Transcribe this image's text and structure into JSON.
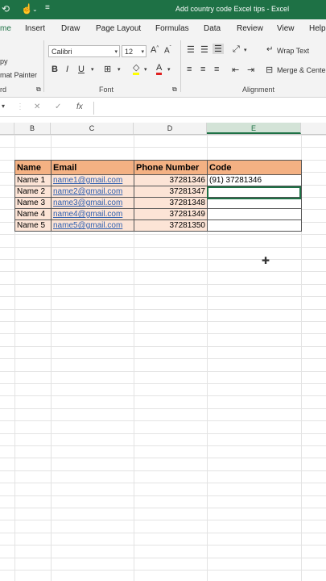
{
  "window": {
    "title": "Add country code Excel tips  -  Excel"
  },
  "tabs": [
    "me",
    "Insert",
    "Draw",
    "Page Layout",
    "Formulas",
    "Data",
    "Review",
    "View",
    "Help"
  ],
  "ribbon": {
    "clipboard": {
      "copy": "py",
      "format_painter": "mat Painter",
      "group": "rd"
    },
    "font": {
      "name": "Calibri",
      "size": "12",
      "group": "Font"
    },
    "alignment": {
      "wrap_text": "Wrap Text",
      "merge_center": "Merge & Cente",
      "group": "Alignment"
    }
  },
  "formula_bar": {
    "fx": "fx",
    "value": ""
  },
  "columns": [
    "B",
    "C",
    "D",
    "E"
  ],
  "table": {
    "headers": [
      "Name",
      "Email",
      "Phone Number",
      "Code"
    ],
    "rows": [
      {
        "name": "Name 1",
        "email": "name1@gmail.com",
        "phone": "37281346",
        "code": "(91) 37281346"
      },
      {
        "name": "Name 2",
        "email": "name2@gmail.com",
        "phone": "37281347",
        "code": ""
      },
      {
        "name": "Name 3",
        "email": "name3@gmail.com",
        "phone": "37281348",
        "code": ""
      },
      {
        "name": "Name 4",
        "email": "name4@gmail.com",
        "phone": "37281349",
        "code": ""
      },
      {
        "name": "Name 5",
        "email": "name5@gmail.com",
        "phone": "37281350",
        "code": ""
      }
    ]
  },
  "colors": {
    "excel_green": "#1e7145",
    "header_fill": "#f4b183",
    "cell_fill": "#fce4d6"
  }
}
